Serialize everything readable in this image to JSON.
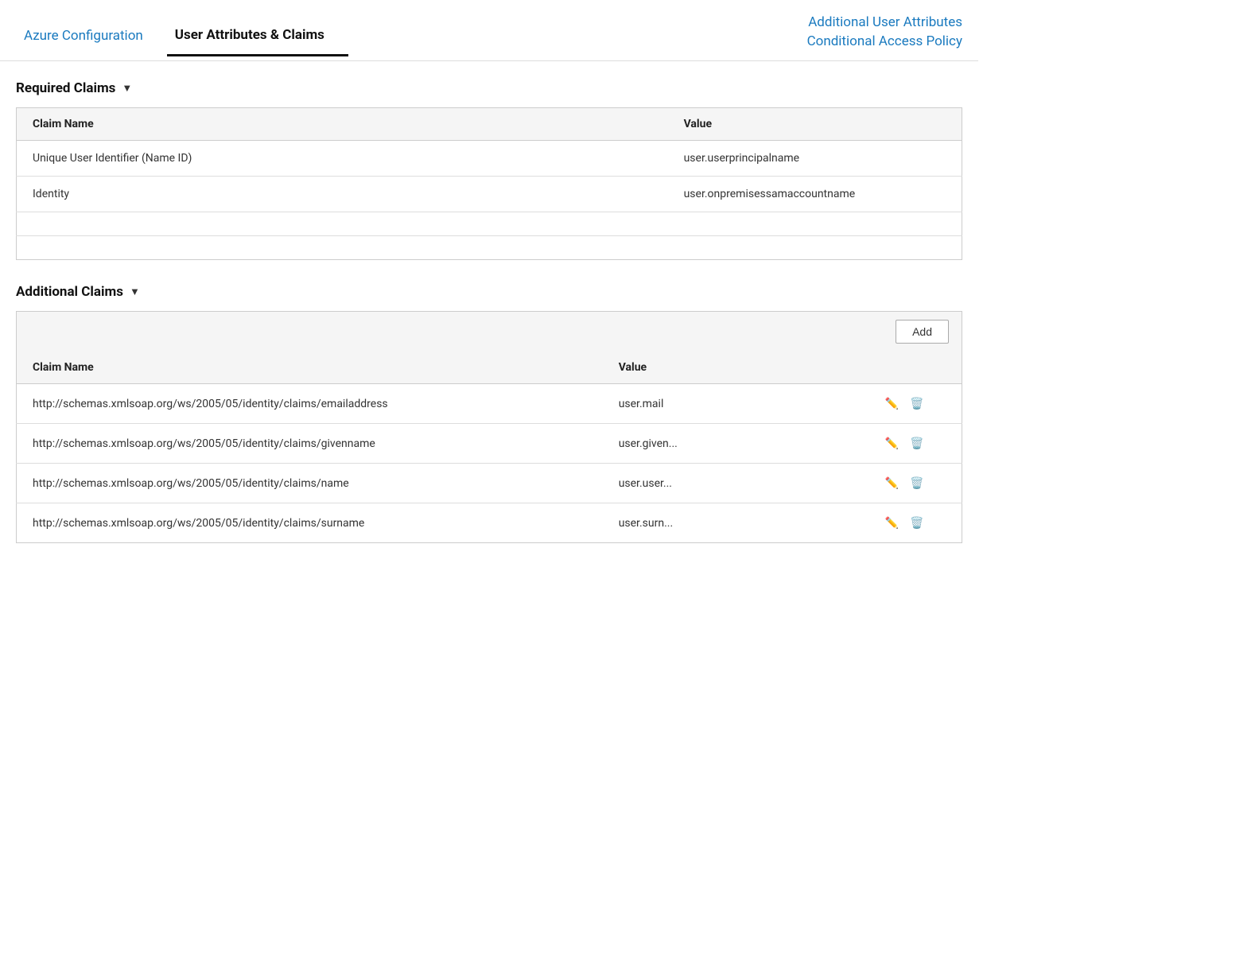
{
  "nav": {
    "tabs": [
      {
        "id": "azure-config",
        "label": "Azure Configuration",
        "active": false
      },
      {
        "id": "user-attributes",
        "label": "User Attributes & Claims",
        "active": true
      },
      {
        "id": "additional-user-attributes",
        "label": "Additional User Attributes",
        "active": false
      },
      {
        "id": "conditional-access",
        "label": "Conditional Access Policy",
        "active": false
      }
    ]
  },
  "required_claims": {
    "section_title": "Required Claims",
    "chevron": "▼",
    "columns": {
      "name": "Claim Name",
      "value": "Value"
    },
    "rows": [
      {
        "name": "Unique User Identifier (Name ID)",
        "value": "user.userprincipalname"
      },
      {
        "name": "Identity",
        "value": "user.onpremisessamaccountname"
      }
    ]
  },
  "additional_claims": {
    "section_title": "Additional Claims",
    "chevron": "▼",
    "add_button_label": "Add",
    "columns": {
      "name": "Claim Name",
      "value": "Value"
    },
    "rows": [
      {
        "name": "http://schemas.xmlsoap.org/ws/2005/05/identity/claims/emailaddress",
        "value": "user.mail"
      },
      {
        "name": "http://schemas.xmlsoap.org/ws/2005/05/identity/claims/givenname",
        "value": "user.given..."
      },
      {
        "name": "http://schemas.xmlsoap.org/ws/2005/05/identity/claims/name",
        "value": "user.user..."
      },
      {
        "name": "http://schemas.xmlsoap.org/ws/2005/05/identity/claims/surname",
        "value": "user.surn..."
      }
    ],
    "edit_icon": "✏",
    "delete_icon": "🗑"
  }
}
